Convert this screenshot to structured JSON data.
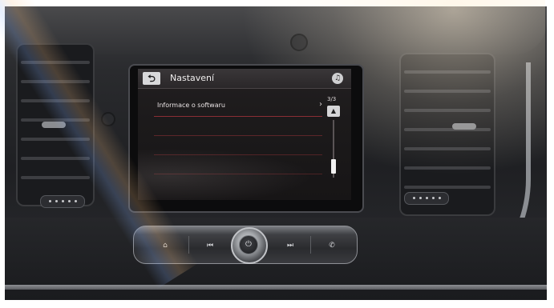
{
  "screen": {
    "header": {
      "back_icon": "back-arrow-icon",
      "back_glyph": "⮌",
      "title": "Nastavení",
      "media_icon": "media-icon",
      "media_glyph": "♫"
    },
    "menu": {
      "items": [
        {
          "label": "Informace o softwaru",
          "arrow_glyph": "›",
          "arrow_icon": "chevron-right-icon"
        }
      ]
    },
    "pagination": {
      "counter": "3/3",
      "scroll_up_glyph": "▲",
      "scroll_up_icon": "scroll-up-icon",
      "scroll_position": 0.9
    }
  },
  "controls": {
    "home_glyph": "⌂",
    "prev_glyph": "⏮",
    "power_glyph": "⏻",
    "next_glyph": "⏭",
    "phone_glyph": "✆",
    "icons": [
      "home-icon",
      "previous-track-icon",
      "power-icon",
      "next-track-icon",
      "phone-icon"
    ]
  },
  "colors": {
    "screen_background": "#1c1a1b",
    "menu_divider": "#8a2e34",
    "text": "#e9e3e4"
  }
}
